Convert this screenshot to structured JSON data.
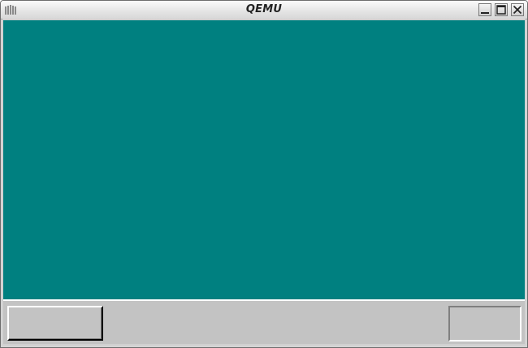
{
  "window": {
    "title": "QEMU",
    "controls": {
      "minimize": "minimize-icon",
      "maximize": "maximize-icon",
      "close": "close-icon"
    }
  },
  "desktop": {
    "background_color": "#008080"
  },
  "taskbar": {
    "background_color": "#c3c3c3",
    "start_button_label": "",
    "tray_text": ""
  }
}
